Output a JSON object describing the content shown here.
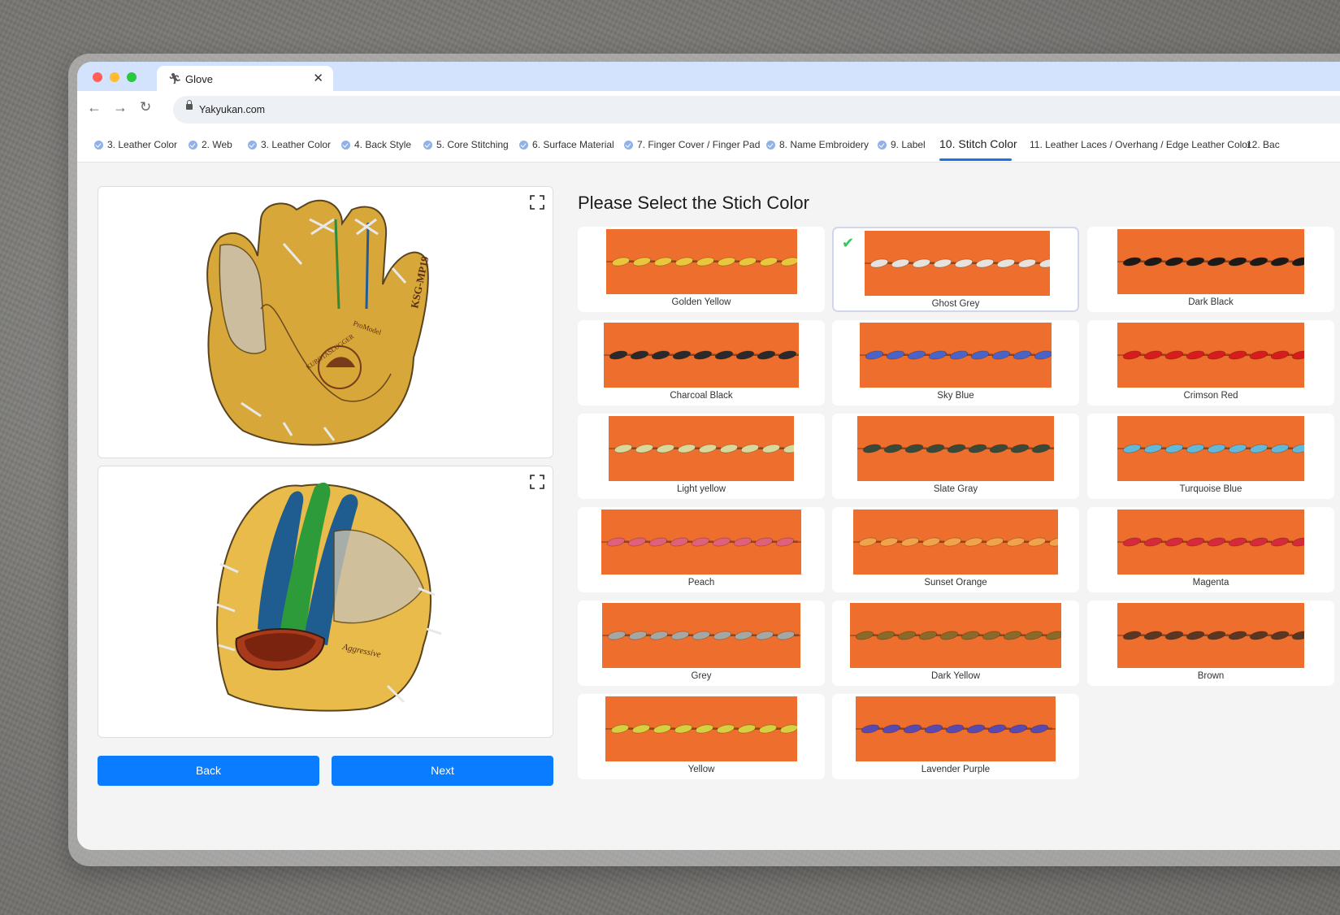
{
  "browser": {
    "tab_title": "Glove",
    "url": "Yakyukan.com",
    "dot_colors": [
      "#ff5f57",
      "#febc2e",
      "#28c840"
    ]
  },
  "steps": [
    {
      "label": "3. Leather Color",
      "done": true
    },
    {
      "label": "2. Web",
      "done": true
    },
    {
      "label": "3. Leather Color",
      "done": true
    },
    {
      "label": "4. Back Style",
      "done": true
    },
    {
      "label": "5. Core Stitching",
      "done": true
    },
    {
      "label": "6. Surface Material",
      "done": true
    },
    {
      "label": "7. Finger Cover / Finger Pad",
      "done": true
    },
    {
      "label": "8. Name Embroidery",
      "done": true
    },
    {
      "label": "9. Label",
      "done": true
    },
    {
      "label": "10. Stitch Color",
      "active": true
    },
    {
      "label": "11. Leather Laces / Overhang / Edge Leather Color"
    },
    {
      "label": "12. Bac"
    }
  ],
  "preview": {
    "palm_model_text": "KSG-MP19",
    "brand_text": "KUBOTASLUGGER",
    "promodel_text": "ProModel",
    "side_text": "Aggressive"
  },
  "buttons": {
    "back": "Back",
    "next": "Next"
  },
  "heading": "Please Select the Stich Color",
  "stitch_options": [
    {
      "label": "Golden Yellow",
      "color": "#e9c63c",
      "selected": false
    },
    {
      "label": "Ghost Grey",
      "color": "#e8e2dc",
      "selected": true
    },
    {
      "label": "Dark Black",
      "color": "#1e1a18",
      "selected": false
    },
    {
      "label": "Charcoal Black",
      "color": "#2a2a2c",
      "selected": false
    },
    {
      "label": "Sky Blue",
      "color": "#4a63c8",
      "selected": false
    },
    {
      "label": "Crimson Red",
      "color": "#d61c1c",
      "selected": false
    },
    {
      "label": "Light yellow",
      "color": "#d8d89a",
      "selected": false
    },
    {
      "label": "Slate Gray",
      "color": "#3b4a38",
      "selected": false
    },
    {
      "label": "Turquoise Blue",
      "color": "#63b8d8",
      "selected": false
    },
    {
      "label": "Peach",
      "color": "#e0607a",
      "selected": false
    },
    {
      "label": "Sunset Orange",
      "color": "#f2a24a",
      "selected": false
    },
    {
      "label": "Magenta",
      "color": "#d42a3a",
      "selected": false
    },
    {
      "label": "Grey",
      "color": "#a6a6a2",
      "selected": false
    },
    {
      "label": "Dark Yellow",
      "color": "#8a6a2a",
      "selected": false
    },
    {
      "label": "Brown",
      "color": "#5a3624",
      "selected": false
    },
    {
      "label": "Yellow",
      "color": "#d6d040",
      "selected": false
    },
    {
      "label": "Lavender Purple",
      "color": "#5a4ab0",
      "selected": false
    }
  ],
  "colors": {
    "accent": "#0a7cff",
    "swatch_leather": "#ee6f2d",
    "success": "#34c759"
  }
}
